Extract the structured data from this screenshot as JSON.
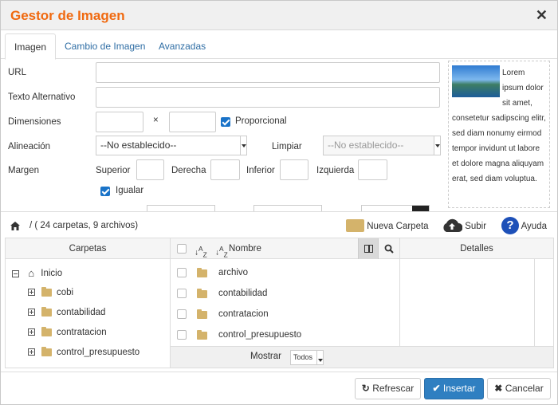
{
  "dialog": {
    "title": "Gestor de Imagen"
  },
  "tabs": [
    {
      "label": "Imagen",
      "active": true
    },
    {
      "label": "Cambio de Imagen",
      "active": false
    },
    {
      "label": "Avanzadas",
      "active": false
    }
  ],
  "form": {
    "url_label": "URL",
    "url_value": "",
    "alt_label": "Texto Alternativo",
    "alt_value": "",
    "dimensions_label": "Dimensiones",
    "width_value": "",
    "height_value": "",
    "times": "×",
    "proportional_label": "Proporcional",
    "proportional_checked": true,
    "align_label": "Alineación",
    "align_value": "--No establecido--",
    "clear_label": "Limpiar",
    "clear_value": "--No establecido--",
    "margin_label": "Margen",
    "margin_top_label": "Superior",
    "margin_right_label": "Derecha",
    "margin_bottom_label": "Inferior",
    "margin_left_label": "Izquierda",
    "equal_label": "Igualar",
    "equal_checked": true
  },
  "preview": {
    "text": "Lorem ipsum dolor sit amet, consetetur sadipscing elitr, sed diam nonumy eirmod tempor invidunt ut labore et dolore magna aliquyam erat, sed diam voluptua."
  },
  "browser": {
    "path": "/ ( 24 carpetas, 9 archivos)",
    "new_folder_label": "Nueva Carpeta",
    "upload_label": "Subir",
    "help_label": "Ayuda",
    "folders_header": "Carpetas",
    "name_header": "Nombre",
    "details_header": "Detalles",
    "tree_root": "Inicio",
    "tree_items": [
      "cobi",
      "contabilidad",
      "contratacion",
      "control_presupuesto"
    ],
    "files": [
      "archivo",
      "contabilidad",
      "contratacion",
      "control_presupuesto"
    ],
    "show_label": "Mostrar",
    "show_value": "Todos"
  },
  "buttons": {
    "refresh": "Refrescar",
    "insert": "Insertar",
    "cancel": "Cancelar"
  },
  "colors": {
    "title": "#f0690f",
    "primary": "#2f7fc1",
    "folder": "#d4b36b",
    "link": "#2e6da4"
  }
}
